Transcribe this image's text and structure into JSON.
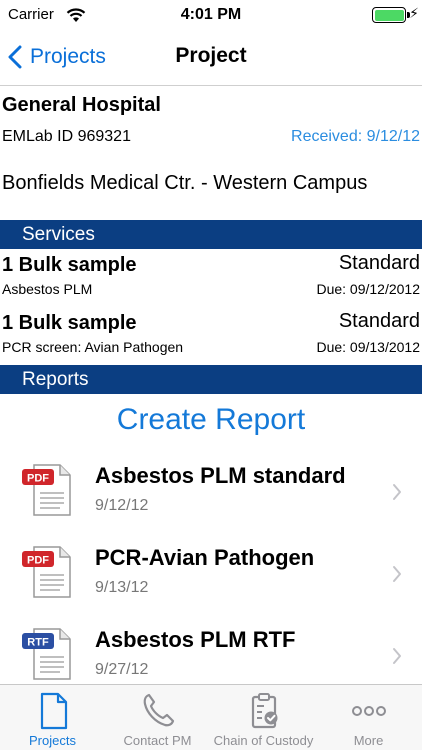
{
  "status_bar": {
    "carrier": "Carrier",
    "time": "4:01 PM"
  },
  "nav": {
    "back_label": "Projects",
    "title": "Project"
  },
  "project": {
    "name": "General Hospital",
    "emlab_id": "EMLab ID 969321",
    "received": "Received: 9/12/12",
    "site": "Bonfields Medical Ctr.  - Western Campus"
  },
  "sections": {
    "services": "Services",
    "reports": "Reports"
  },
  "services": [
    {
      "quantity": "1 Bulk sample",
      "name": "Asbestos PLM",
      "type": "Standard",
      "due": "Due: 09/12/2012"
    },
    {
      "quantity": "1 Bulk sample",
      "name": "PCR screen: Avian Pathogen",
      "type": "Standard",
      "due": "Due: 09/13/2012"
    }
  ],
  "create_report_label": "Create Report",
  "reports": [
    {
      "badge": "PDF",
      "title": "Asbestos PLM standard",
      "date": "9/12/12"
    },
    {
      "badge": "PDF",
      "title": "PCR-Avian Pathogen",
      "date": "9/13/12"
    },
    {
      "badge": "RTF",
      "title": "Asbestos PLM RTF",
      "date": "9/27/12"
    }
  ],
  "tabs": [
    {
      "label": "Projects"
    },
    {
      "label": "Contact PM"
    },
    {
      "label": "Chain of Custody"
    },
    {
      "label": "More"
    }
  ],
  "colors": {
    "accent": "#1479d8",
    "section_header": "#0b3e82",
    "pdf_badge": "#d0262b",
    "rtf_badge": "#2b4fa3",
    "battery": "#4cd964"
  }
}
